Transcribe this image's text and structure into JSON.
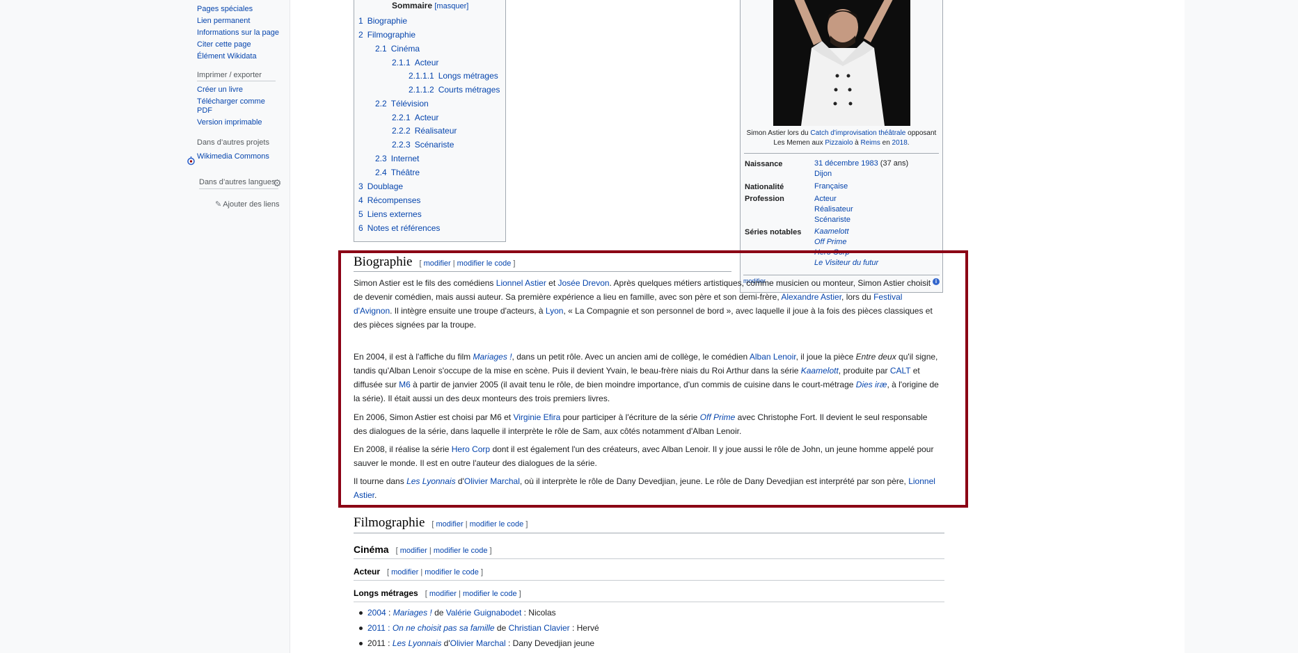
{
  "sidebar": {
    "tools": [
      "Pages spéciales",
      "Lien permanent",
      "Informations sur la page",
      "Citer cette page",
      "Élément Wikidata"
    ],
    "print_heading": "Imprimer / exporter",
    "print_items": [
      "Créer un livre",
      "Télécharger comme PDF",
      "Version imprimable"
    ],
    "projects_heading": "Dans d’autres projets",
    "commons": "Wikimedia Commons",
    "languages_heading": "Dans d’autres langues",
    "add_links": "Ajouter des liens"
  },
  "toc": {
    "title": "Sommaire",
    "toggle": "[masquer]",
    "entries": [
      {
        "num": "1",
        "label": "Biographie"
      },
      {
        "num": "2",
        "label": "Filmographie"
      },
      {
        "num": "2.1",
        "label": "Cinéma"
      },
      {
        "num": "2.1.1",
        "label": "Acteur"
      },
      {
        "num": "2.1.1.1",
        "label": "Longs métrages"
      },
      {
        "num": "2.1.1.2",
        "label": "Courts métrages"
      },
      {
        "num": "2.2",
        "label": "Télévision"
      },
      {
        "num": "2.2.1",
        "label": "Acteur"
      },
      {
        "num": "2.2.2",
        "label": "Réalisateur"
      },
      {
        "num": "2.2.3",
        "label": "Scénariste"
      },
      {
        "num": "2.3",
        "label": "Internet"
      },
      {
        "num": "2.4",
        "label": "Théâtre"
      },
      {
        "num": "3",
        "label": "Doublage"
      },
      {
        "num": "4",
        "label": "Récompenses"
      },
      {
        "num": "5",
        "label": "Liens externes"
      },
      {
        "num": "6",
        "label": "Notes et références"
      }
    ]
  },
  "infobox": {
    "caption_pre": "Simon Astier lors du ",
    "caption_link1": "Catch d'improvisation théâtrale",
    "caption_mid": " opposant Les Memen aux ",
    "caption_link2": "Pizzaiolo",
    "caption_a": " à ",
    "caption_link3": "Reims",
    "caption_en": " en ",
    "caption_link4": "2018",
    "caption_end": ".",
    "naissance_label": "Naissance",
    "naissance_date": "31 décembre 1983",
    "naissance_age": " (37 ans)",
    "naissance_lieu": "Dijon",
    "nationalite_label": "Nationalité",
    "nationalite": "Française",
    "profession_label": "Profession",
    "professions": [
      "Acteur",
      "Réalisateur",
      "Scénariste"
    ],
    "series_label": "Séries notables",
    "series": [
      "Kaamelott",
      "Off Prime",
      "Hero Corp",
      "Le Visiteur du futur"
    ],
    "edit": "modifier",
    "info_icon": "i"
  },
  "edit_links": {
    "modifier": "modifier",
    "modifier_code": "modifier le code",
    "open": "[",
    "sep": " | ",
    "close": "]"
  },
  "bio": {
    "heading": "Biographie",
    "p1": {
      "a": "Simon Astier est le fils des comédiens ",
      "l1": "Lionnel Astier",
      "b": " et ",
      "l2": "Josée Drevon",
      "c": ". Après quelques métiers artistiques, comme musicien ou monteur, Simon Astier choisit de devenir comédien, mais aussi auteur. Sa première expérience a lieu en famille, avec son père et son demi-frère, ",
      "l3": "Alexandre Astier",
      "d": ", lors du ",
      "l4": "Festival d'Avignon",
      "e": ". Il intègre ensuite une troupe d'acteurs, à ",
      "l5": "Lyon",
      "f": ", « La Compagnie et son personnel de bord », avec laquelle il joue à la fois des pièces classiques et des pièces signées par la troupe."
    },
    "p2": {
      "a": "En 2004, il est à l'affiche du film ",
      "l1": "Mariages !",
      "b": ", dans un petit rôle. Avec un ancien ami de collège, le comédien ",
      "l2": "Alban Lenoir",
      "c": ", il joue la pièce ",
      "i1": "Entre deux",
      "d": " qu'il signe, tandis qu'Alban Lenoir s'occupe de la mise en scène. Puis il devient Yvain, le beau-frère niais du Roi Arthur dans la série ",
      "l3": "Kaamelott",
      "e": ", produite par ",
      "l4": "CALT",
      "f": " et diffusée sur ",
      "l5": "M6",
      "g": " à partir de janvier 2005 (il avait tenu le rôle, de bien moindre importance, d'un commis de cuisine dans le court-métrage ",
      "l6": "Dies iræ",
      "h": ", à l'origine de la série). Il était aussi un des deux monteurs des trois premiers livres."
    },
    "p3": {
      "a": "En 2006, Simon Astier est choisi par M6 et ",
      "l1": "Virginie Efira",
      "b": " pour participer à l'écriture de la série ",
      "l2": "Off Prime",
      "c": " avec Christophe Fort. Il devient le seul responsable des dialogues de la série, dans laquelle il interprète le rôle de Sam, aux côtés notamment d'Alban Lenoir."
    },
    "p4": {
      "a": "En 2008, il réalise la série ",
      "l1": "Hero Corp",
      "b": " dont il est également l'un des créateurs, avec Alban Lenoir. Il y joue aussi le rôle de John, un jeune homme appelé pour sauver le monde. Il est en outre l'auteur des dialogues de la série."
    },
    "p5": {
      "a": "Il tourne dans ",
      "l1": "Les Lyonnais",
      "b": " d'",
      "l2": "Olivier Marchal",
      "c": ", où il interprète le rôle de Dany Devedjian, jeune. Le rôle de Dany Devedjian est interprété par son père, ",
      "l3": "Lionnel Astier",
      "d": "."
    }
  },
  "filmo": {
    "heading": "Filmographie",
    "cinema": "Cinéma",
    "acteur": "Acteur",
    "longs": "Longs métrages",
    "items": [
      {
        "year": "2004",
        "sep": " : ",
        "film": "Mariages !",
        "de": " de ",
        "director": "Valérie Guignabodet",
        "role": " : Nicolas"
      },
      {
        "year": "2011",
        "sep": " : ",
        "film": "On ne choisit pas sa famille",
        "de": " de ",
        "director": "Christian Clavier",
        "role": " : Hervé"
      },
      {
        "year": "2011",
        "sep": " : ",
        "film": "Les Lyonnais",
        "de": " d'",
        "director": "Olivier Marchal",
        "role": " : Dany Devedjian jeune"
      }
    ]
  }
}
